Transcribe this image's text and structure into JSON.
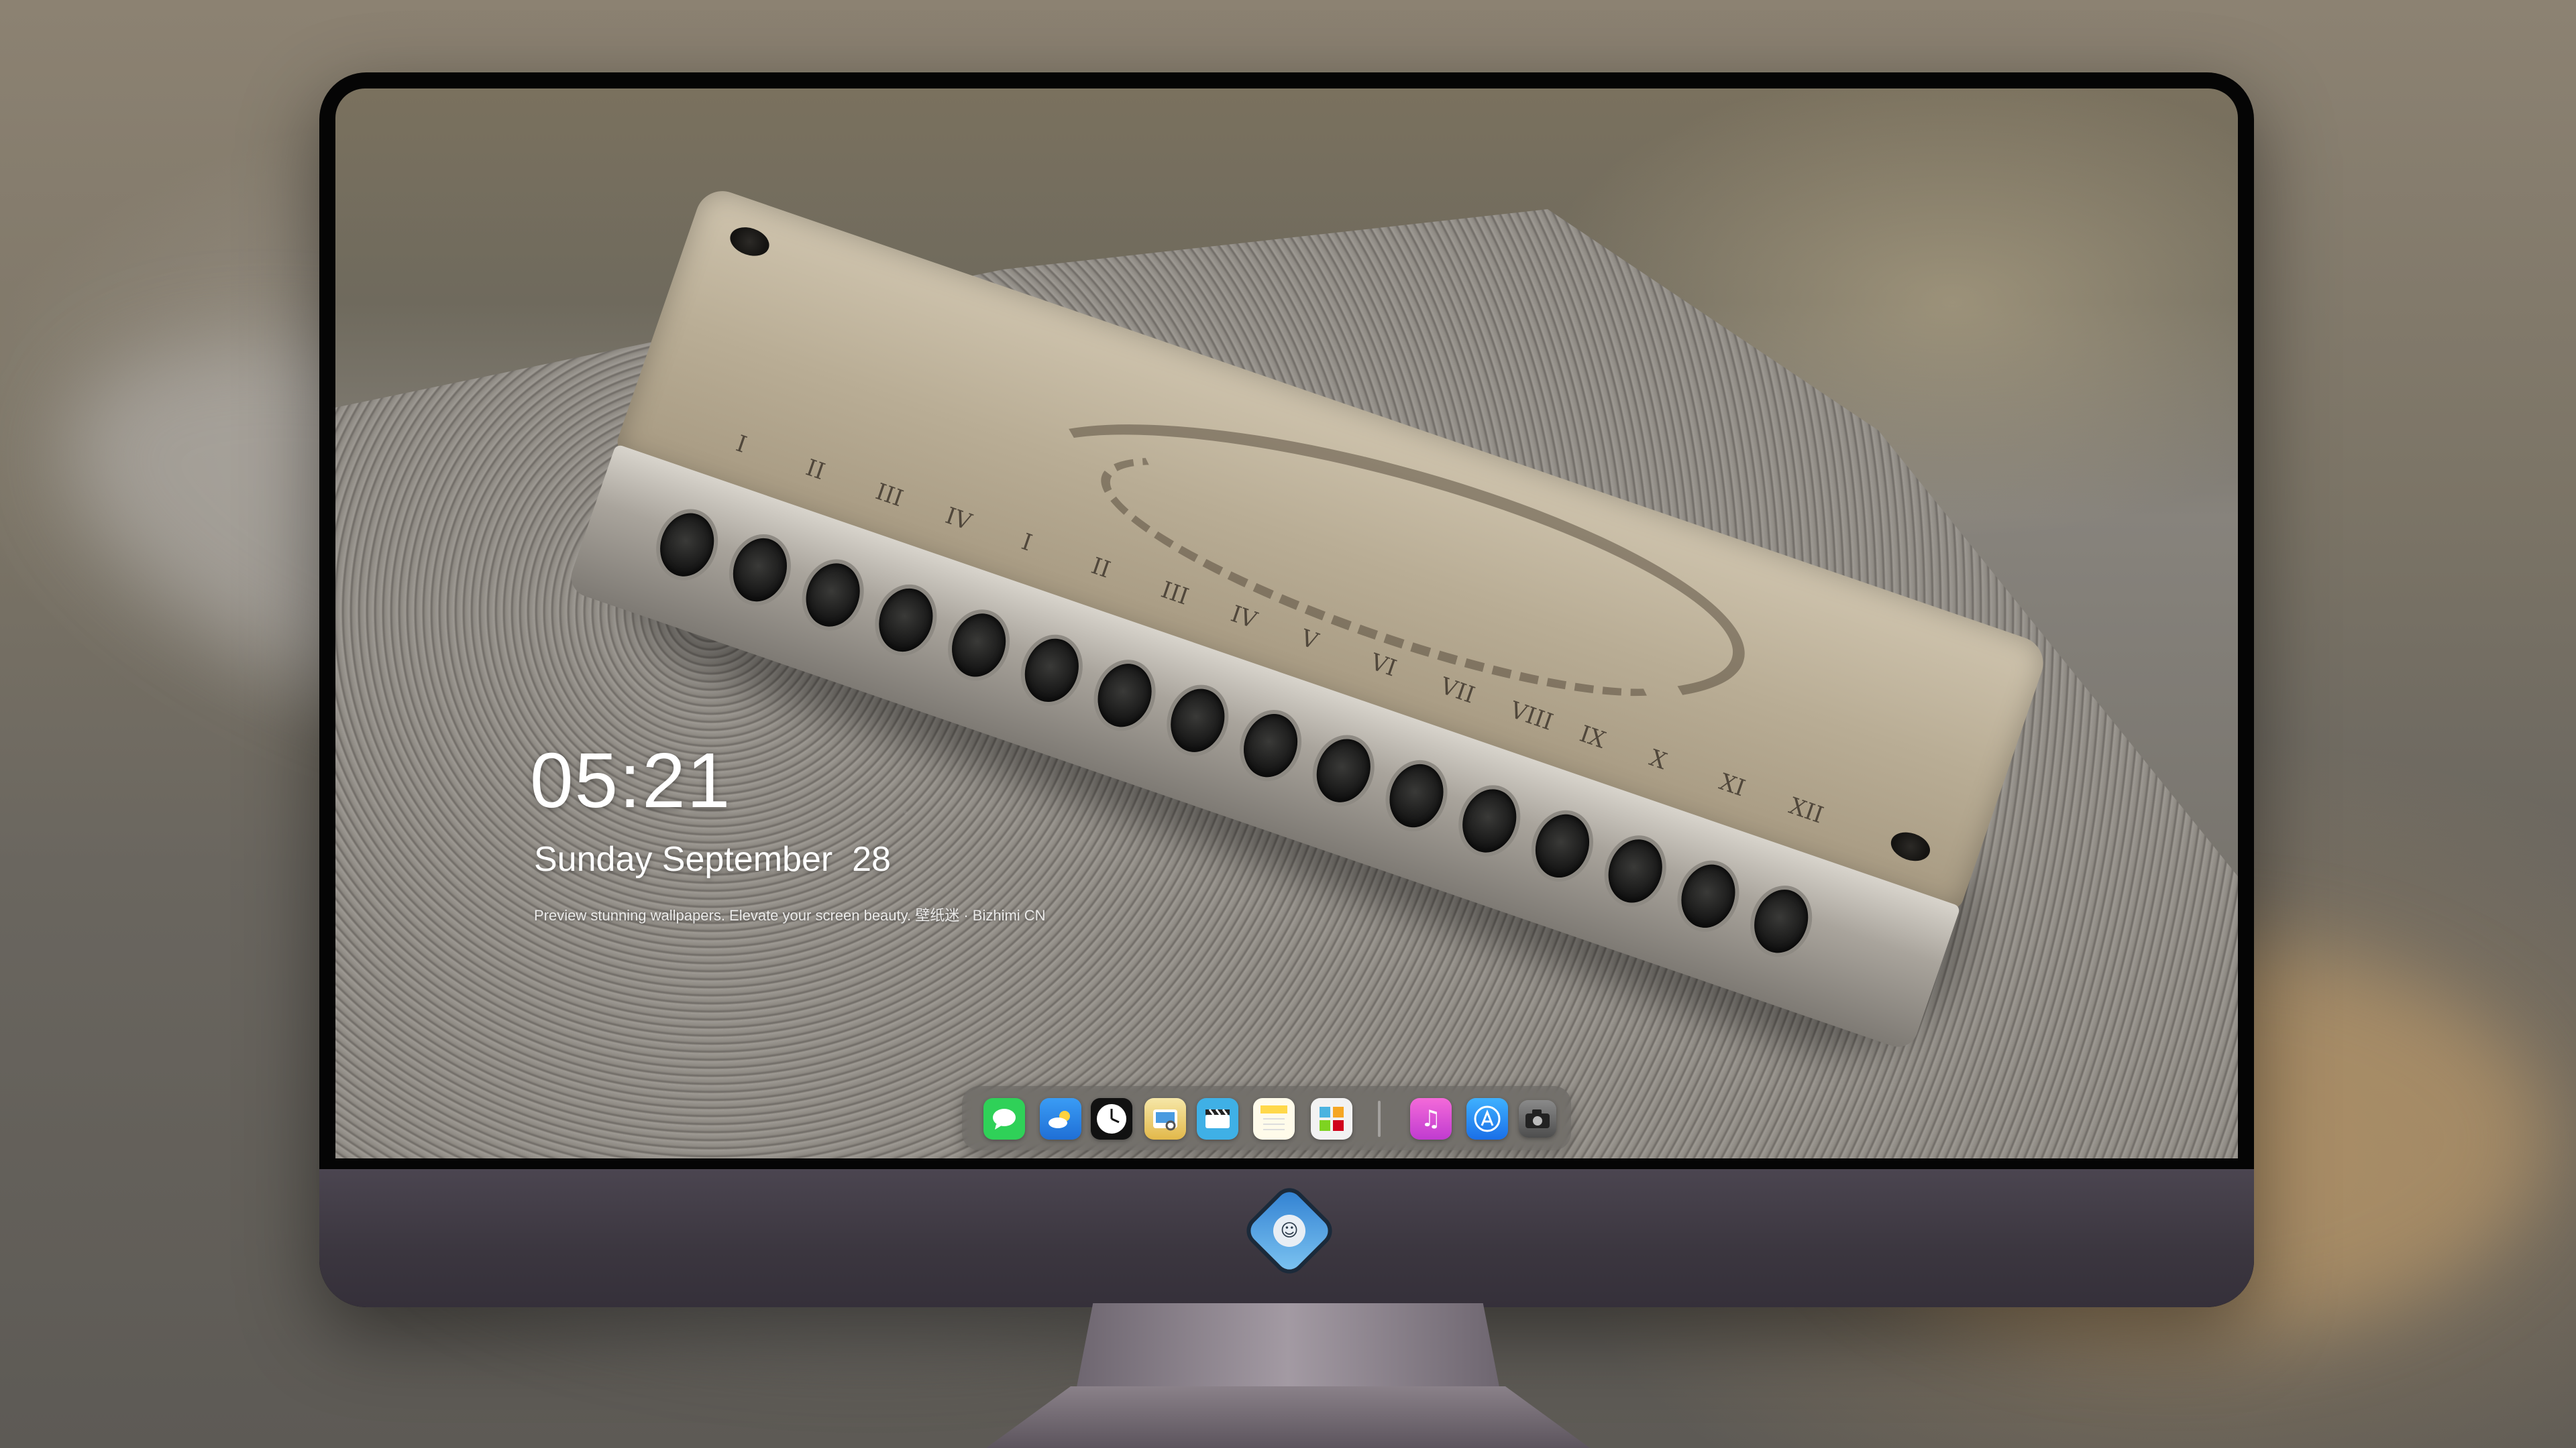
{
  "lockscreen": {
    "time": "05:21",
    "date": "Sunday September  28",
    "tagline": "Preview stunning wallpapers. Elevate your screen beauty. 壁纸迷 · Bizhimi CN"
  },
  "harmonica": {
    "numerals": [
      "I",
      "II",
      "III",
      "IV",
      "I",
      "II",
      "III",
      "IV",
      "V",
      "VI",
      "VII",
      "VIII",
      "IX",
      "X",
      "XI",
      "XII"
    ]
  },
  "dock": {
    "apps": [
      {
        "name": "Messages",
        "icon": "message-bubble",
        "color": "#2fd158"
      },
      {
        "name": "Weather",
        "icon": "cloud-sun",
        "color": "#2f8ff0"
      },
      {
        "name": "Clock",
        "icon": "clock",
        "color": "#111111"
      },
      {
        "name": "Preview",
        "icon": "preview",
        "color": "#e9c35a"
      },
      {
        "name": "Clips",
        "icon": "clapperboard",
        "color": "#3fb0e6"
      },
      {
        "name": "Notes",
        "icon": "note",
        "color": "#ffd84a"
      },
      {
        "name": "Photo Booth",
        "icon": "grid",
        "color": "#4bb3e0"
      },
      {
        "name": "iTunes",
        "icon": "music-note",
        "color": "#e35bd6"
      },
      {
        "name": "App Store",
        "icon": "app-store",
        "color": "#1d8cf2"
      },
      {
        "name": "Camera",
        "icon": "camera",
        "color": "#6a6a6a"
      }
    ]
  },
  "colors": {
    "bezel": "#050505",
    "chin": "#3b363f",
    "logo": "#2f7fd1"
  }
}
